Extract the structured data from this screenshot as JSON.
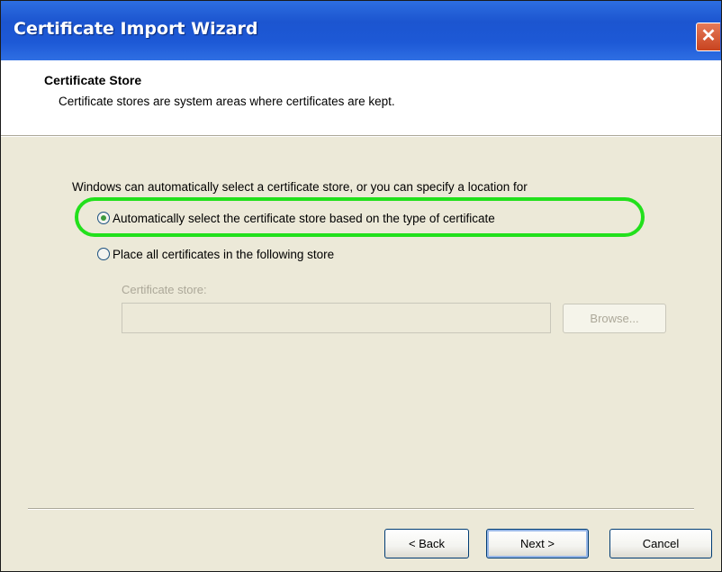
{
  "window": {
    "title": "Certificate Import Wizard",
    "close_glyph": "✕"
  },
  "header": {
    "title": "Certificate Store",
    "subtitle": "Certificate stores are system areas where certificates are kept."
  },
  "body": {
    "intro": "Windows can automatically select a certificate store, or you can specify a location for",
    "options": [
      {
        "label": "Automatically select the certificate store based on the type of certificate",
        "selected": true
      },
      {
        "label": "Place all certificates in the following store",
        "selected": false
      }
    ],
    "store_field": {
      "label": "Certificate store:",
      "value": "",
      "enabled": false
    },
    "browse_label": "Browse..."
  },
  "buttons": {
    "back": "< Back",
    "next": "Next >",
    "cancel": "Cancel"
  },
  "colors": {
    "highlight": "#22e01c",
    "titlebar": "#1c55d0"
  }
}
